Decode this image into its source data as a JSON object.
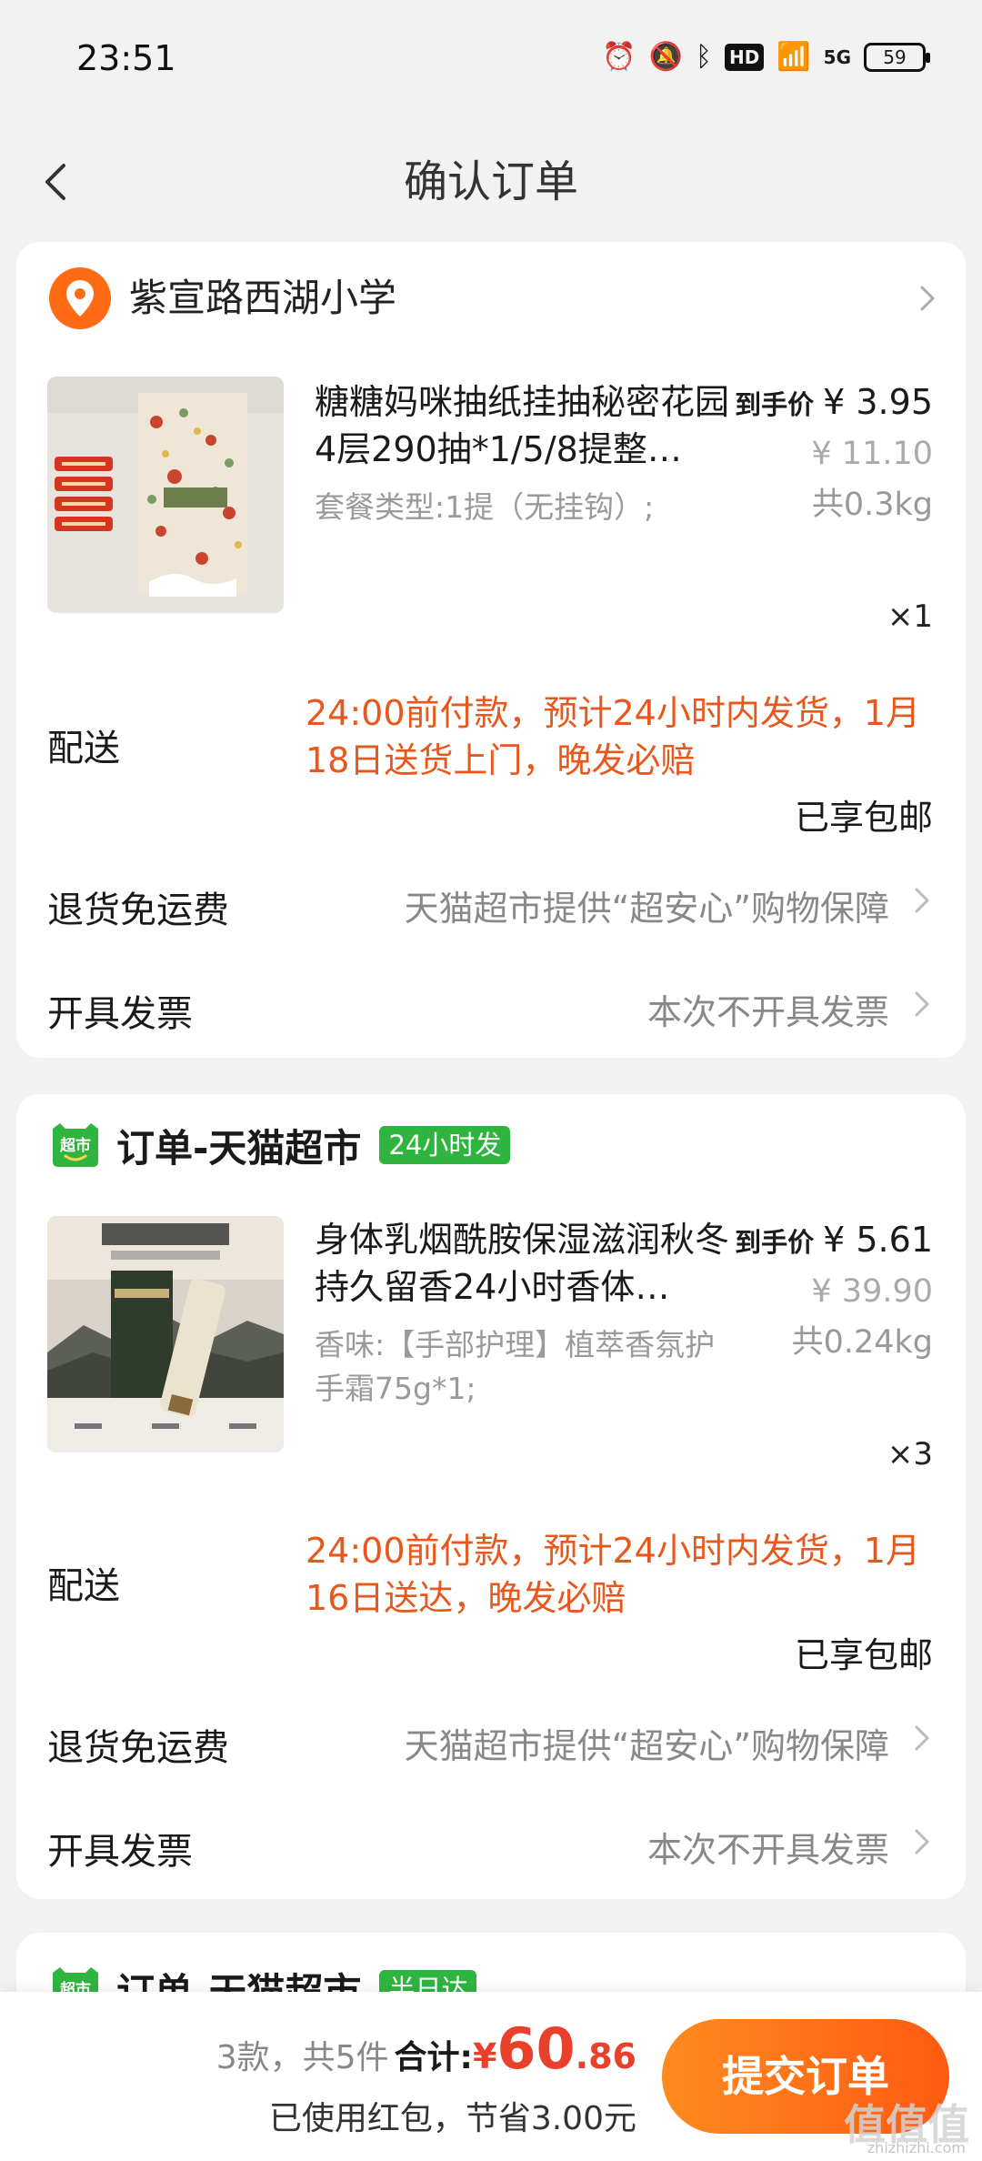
{
  "status_bar": {
    "time": "23:51",
    "battery": "59",
    "network": "5G"
  },
  "nav": {
    "title": "确认订单"
  },
  "address": {
    "text": "紫宣路西湖小学"
  },
  "orders": [
    {
      "product": {
        "title": "糖糖妈咪抽纸挂抽秘密花园4层290抽*1/5/8提整…",
        "spec": "套餐类型:1提（无挂钩）;",
        "price_label": "到手价",
        "price": "¥ 3.95",
        "original_price": "¥ 11.10",
        "weight": "共0.3kg",
        "quantity": "×1"
      },
      "delivery": {
        "label": "配送",
        "note": "24:00前付款，预计24小时内发货，1月18日送货上门，晚发必赔",
        "free_shipping": "已享包邮"
      },
      "return_row": {
        "label": "退货免运费",
        "value": "天猫超市提供“超安心”购物保障"
      },
      "invoice_row": {
        "label": "开具发票",
        "value": "本次不开具发票"
      }
    },
    {
      "header": {
        "title": "订单-天猫超市",
        "badge": "24小时发",
        "icon_text": "超市"
      },
      "product": {
        "title": "身体乳烟酰胺保湿滋润秋冬持久留香24小时香体…",
        "spec": "香味:【手部护理】植萃香氛护手霜75g*1;",
        "price_label": "到手价",
        "price": "¥ 5.61",
        "original_price": "¥ 39.90",
        "weight": "共0.24kg",
        "quantity": "×3"
      },
      "delivery": {
        "label": "配送",
        "note": "24:00前付款，预计24小时内发货，1月16日送达，晚发必赔",
        "free_shipping": "已享包邮"
      },
      "return_row": {
        "label": "退货免运费",
        "value": "天猫超市提供“超安心”购物保障"
      },
      "invoice_row": {
        "label": "开具发票",
        "value": "本次不开具发票"
      }
    },
    {
      "header": {
        "title": "订单-天猫超市",
        "badge": "半日达",
        "icon_text": "超市"
      }
    }
  ],
  "summary": {
    "count": "3款，共5件",
    "total_label": "合计:",
    "currency": "¥",
    "total_int": "60",
    "total_dec": ".86",
    "discount_note": "已使用红包，节省3.00元",
    "submit_label": "提交订单"
  },
  "watermark": {
    "text": "值值值",
    "sub": "zhizhizhi.com"
  },
  "colors": {
    "accent": "#ff6a14",
    "price_red": "#e8402b",
    "note_orange": "#e8571c",
    "badge_green": "#2fb53f"
  }
}
